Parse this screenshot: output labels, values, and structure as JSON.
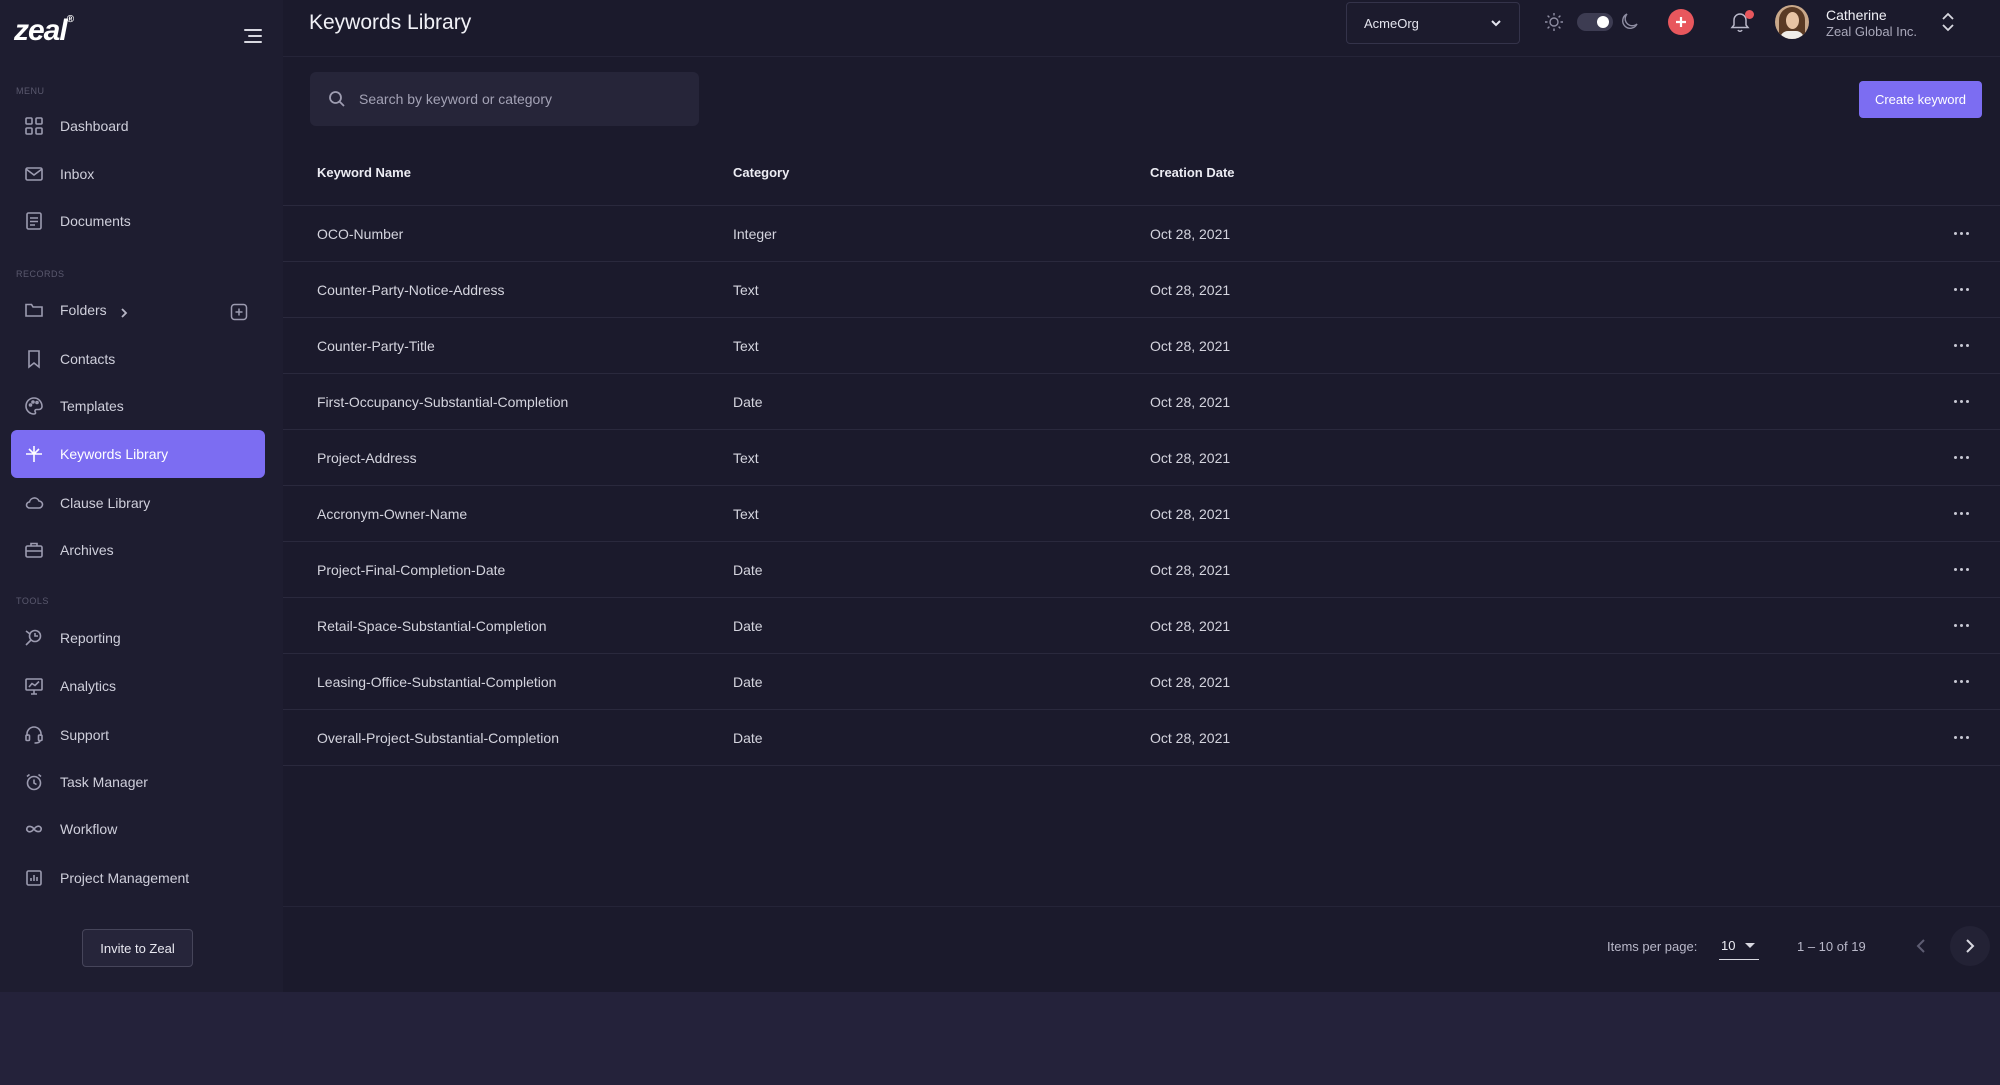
{
  "brand": {
    "logo": "zeal",
    "accent": "#7c6df2"
  },
  "sidebar": {
    "toggle_icon": "hamburger-icon",
    "sections": {
      "menu": "MENU",
      "records": "RECORDS",
      "tools": "TOOLS"
    },
    "items": [
      {
        "label": "Dashboard",
        "icon": "grid-icon"
      },
      {
        "label": "Inbox",
        "icon": "mail-icon"
      },
      {
        "label": "Documents",
        "icon": "document-icon"
      },
      {
        "label": "Folders",
        "icon": "folder-icon"
      },
      {
        "label": "Contacts",
        "icon": "bookmark-icon"
      },
      {
        "label": "Templates",
        "icon": "palette-icon"
      },
      {
        "label": "Keywords Library",
        "icon": "keyword-icon",
        "active": true
      },
      {
        "label": "Clause Library",
        "icon": "cloud-icon"
      },
      {
        "label": "Archives",
        "icon": "briefcase-icon"
      },
      {
        "label": "Reporting",
        "icon": "reporting-icon"
      },
      {
        "label": "Analytics",
        "icon": "analytics-icon"
      },
      {
        "label": "Support",
        "icon": "headset-icon"
      },
      {
        "label": "Task Manager",
        "icon": "alarm-icon"
      },
      {
        "label": "Workflow",
        "icon": "infinity-icon"
      },
      {
        "label": "Project Management",
        "icon": "chart-box-icon"
      }
    ],
    "invite_label": "Invite to Zeal"
  },
  "header": {
    "title": "Keywords Library",
    "org_select": "AcmeOrg",
    "user": {
      "name": "Catherine",
      "org": "Zeal Global Inc."
    }
  },
  "search": {
    "placeholder": "Search by keyword or category"
  },
  "create_label": "Create keyword",
  "table": {
    "columns": [
      "Keyword Name",
      "Category",
      "Creation Date"
    ],
    "rows": [
      [
        "OCO-Number",
        "Integer",
        "Oct 28, 2021"
      ],
      [
        "Counter-Party-Notice-Address",
        "Text",
        "Oct 28, 2021"
      ],
      [
        "Counter-Party-Title",
        "Text",
        "Oct 28, 2021"
      ],
      [
        "First-Occupancy-Substantial-Completion",
        "Date",
        "Oct 28, 2021"
      ],
      [
        "Project-Address",
        "Text",
        "Oct 28, 2021"
      ],
      [
        "Accronym-Owner-Name",
        "Text",
        "Oct 28, 2021"
      ],
      [
        "Project-Final-Completion-Date",
        "Date",
        "Oct 28, 2021"
      ],
      [
        "Retail-Space-Substantial-Completion",
        "Date",
        "Oct 28, 2021"
      ],
      [
        "Leasing-Office-Substantial-Completion",
        "Date",
        "Oct 28, 2021"
      ],
      [
        "Overall-Project-Substantial-Completion",
        "Date",
        "Oct 28, 2021"
      ]
    ]
  },
  "pagination": {
    "items_per_page_label": "Items per page:",
    "items_per_page": "10",
    "range": "1 – 10 of 19"
  }
}
